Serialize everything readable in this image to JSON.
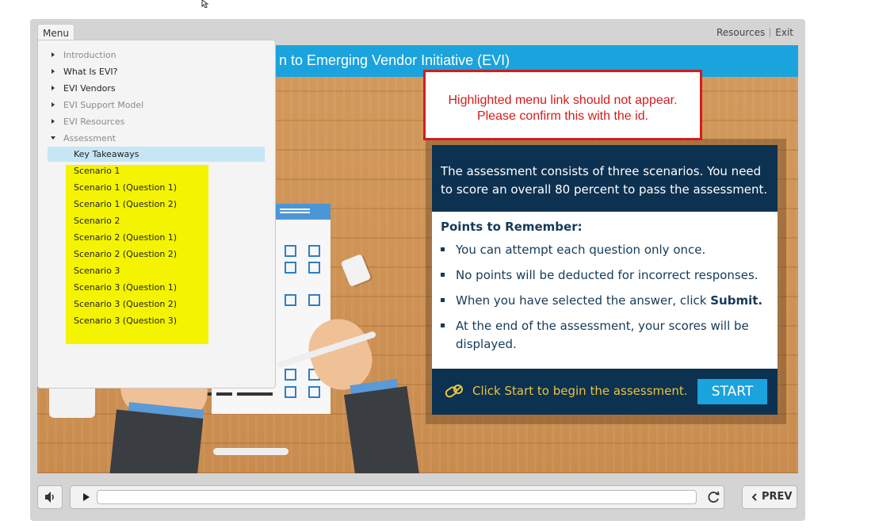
{
  "topbar": {
    "resources_label": "Resources",
    "exit_label": "Exit"
  },
  "menu": {
    "tab_label": "Menu",
    "items": [
      {
        "label": "Introduction",
        "dim": true,
        "expanded": false
      },
      {
        "label": "What Is EVI?",
        "dim": false,
        "expanded": false
      },
      {
        "label": "EVI Vendors",
        "dim": false,
        "expanded": false
      },
      {
        "label": "EVI Support Model",
        "dim": true,
        "expanded": false
      },
      {
        "label": "EVI Resources",
        "dim": true,
        "expanded": false
      },
      {
        "label": "Assessment",
        "dim": true,
        "expanded": true
      }
    ],
    "selected": "Key Takeaways",
    "subitems": [
      "Scenario 1",
      "Scenario 1 (Question 1)",
      "Scenario 1 (Question 2)",
      "Scenario 2",
      "Scenario 2 (Question 1)",
      "Scenario 2 (Question 2)",
      "Scenario 3",
      "Scenario 3 (Question 1)",
      "Scenario 3 (Question 2)",
      "Scenario 3 (Question 3)"
    ]
  },
  "slide": {
    "title": "n to Emerging Vendor Initiative (EVI)",
    "callout_line1": "Highlighted menu link should not appear.",
    "callout_line2": "Please confirm this with the id.",
    "intro": "The assessment consists of three scenarios. You need to score an overall 80 percent to pass the assessment.",
    "points_heading": "Points to Remember:",
    "points": [
      "You can attempt each question only once.",
      "No points will be deducted for incorrect responses.",
      "When you have selected the answer, click ",
      "At the end of the assessment, your scores will be displayed."
    ],
    "submit_word": "Submit.",
    "footer_text": "Click Start to begin the assessment.",
    "start_label": "START"
  },
  "controls": {
    "prev_label": "PREV"
  },
  "colors": {
    "accent": "#1aa3dd",
    "navy": "#0d3150",
    "callout_red": "#d61b1b",
    "highlight_yellow": "#f4f400"
  },
  "icons": [
    "mouse-cursor-icon",
    "volume-icon",
    "play-icon",
    "replay-icon",
    "chevron-left-icon",
    "pills-icon"
  ]
}
